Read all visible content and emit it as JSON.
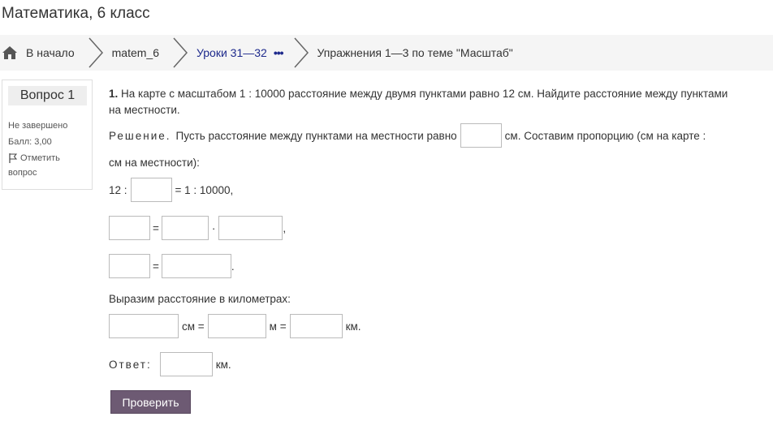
{
  "course": {
    "title": "Математика, 6 класс"
  },
  "breadcrumb": {
    "home": "В начало",
    "course": "matem_6",
    "section": "Уроки 31—32",
    "more": "•••",
    "current": "Упражнения 1—3 по теме \"Масштаб\""
  },
  "question_info": {
    "label": "Вопрос 1",
    "status": "Не завершено",
    "score": "Балл: 3,00",
    "flag_line1": "Отметить",
    "flag_line2": "вопрос"
  },
  "question": {
    "number": "1.",
    "text": "На карте с масштабом 1 : 10000 расстояние между двумя пунктами равно 12 см. Найдите расстояние между пунктами на местности.",
    "solution_label": "Решение.",
    "solution_text1": "Пусть расстояние между пунктами на местности равно",
    "solution_text2": "см. Составим пропорцию (см на карте :",
    "solution_text3": "см на местности):",
    "prop_left": "12 :",
    "prop_right": "= 1 : 10000,",
    "eq_sign": "=",
    "mult_sign": "·",
    "comma": ",",
    "period": ".",
    "km_intro": "Выразим расстояние в километрах:",
    "unit_cm_eq": "см =",
    "unit_m_eq": "м =",
    "unit_km": "км.",
    "answer_label": "Ответ:",
    "answer_unit": "км."
  },
  "inputs": {
    "x_value": "",
    "prop_value": "",
    "eq1_left": "",
    "eq1_mid": "",
    "eq1_right": "",
    "eq2_left": "",
    "eq2_right": "",
    "cm_value": "",
    "m_value": "",
    "km_value": "",
    "answer_value": ""
  },
  "actions": {
    "check": "Проверить"
  },
  "colors": {
    "button": "#6d5a73",
    "link": "#1e2a8c",
    "breadcrumb_bg": "#f5f5f5"
  }
}
